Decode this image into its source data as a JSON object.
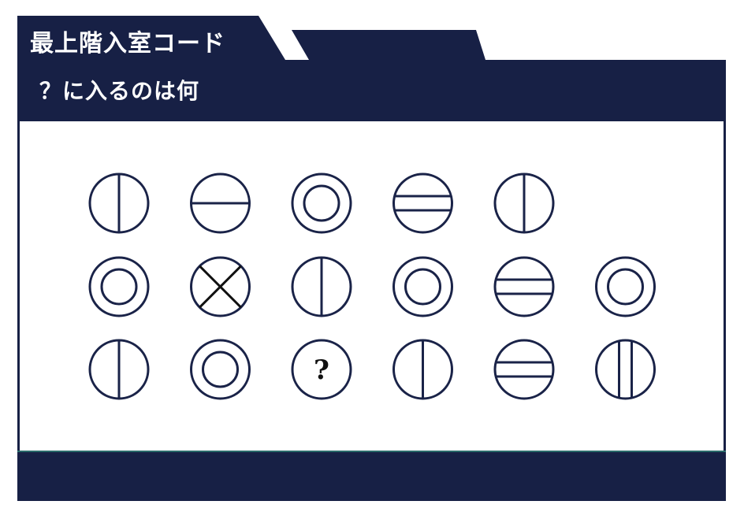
{
  "header": {
    "title": "最上階入室コード",
    "subtitle": "？に入るのは何"
  },
  "puzzle": {
    "rows": [
      [
        "vertical-line",
        "horizontal-line",
        "double-circle",
        "double-horizontal-line",
        "vertical-line"
      ],
      [
        "double-circle",
        "x-cross",
        "vertical-line",
        "double-circle",
        "double-horizontal-line",
        "double-circle"
      ],
      [
        "vertical-line",
        "double-circle",
        "question",
        "vertical-line",
        "double-horizontal-line",
        "double-vertical-line"
      ]
    ],
    "question_mark": "?"
  },
  "colors": {
    "navy": "#172045",
    "stroke": "#1a2348",
    "cross_stroke": "#111111",
    "text_light": "#ffffff"
  }
}
